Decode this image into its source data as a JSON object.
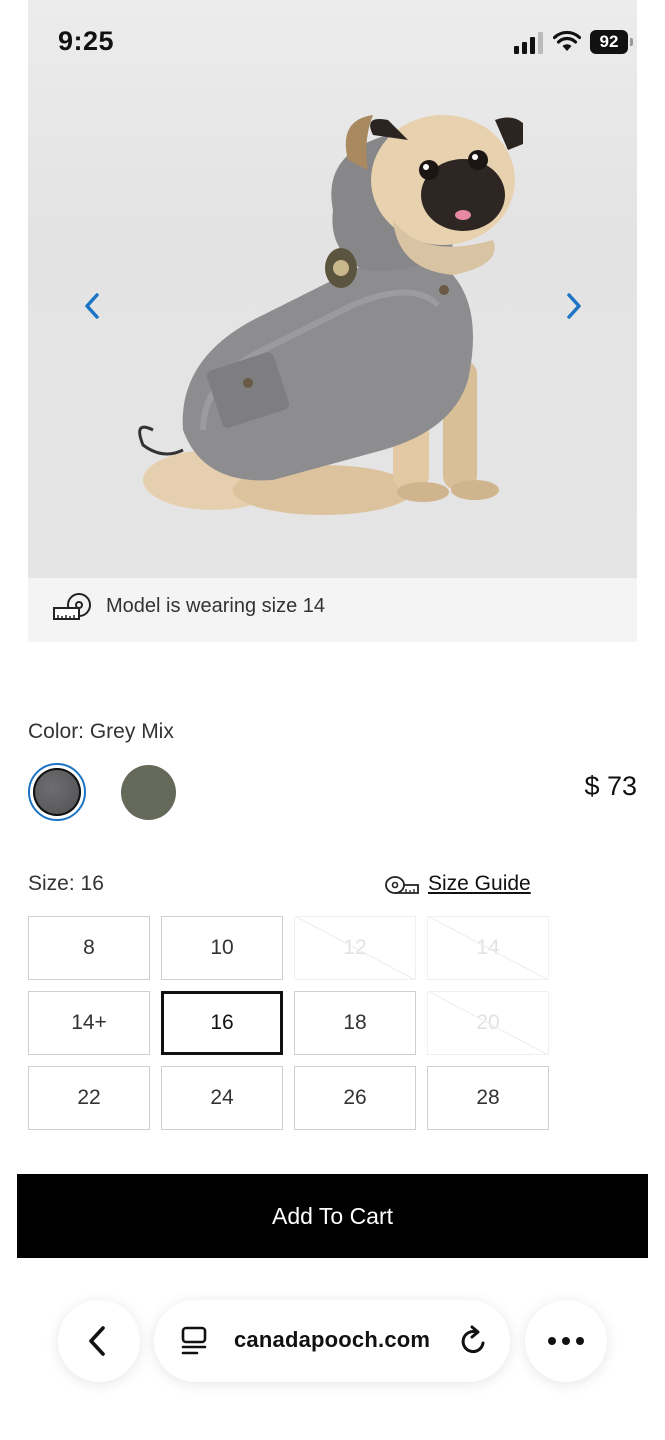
{
  "status_bar": {
    "time": "9:25",
    "battery": "92"
  },
  "gallery": {
    "prev_icon": "chevron-left-icon",
    "next_icon": "chevron-right-icon",
    "accent_color": "#1d74c4"
  },
  "model_note": {
    "icon": "measuring-tape-icon",
    "text": "Model is wearing size 14"
  },
  "color": {
    "label": "Color: Grey Mix",
    "swatches": [
      {
        "name": "Grey Mix",
        "hex": "#58585b",
        "selected": true
      },
      {
        "name": "Olive",
        "hex": "#65695a",
        "selected": false
      }
    ]
  },
  "price": "$ 73",
  "size": {
    "label": "Size: 16",
    "guide_label": "Size Guide",
    "options": [
      {
        "label": "8",
        "state": "available"
      },
      {
        "label": "10",
        "state": "available"
      },
      {
        "label": "12",
        "state": "unavailable"
      },
      {
        "label": "14",
        "state": "unavailable"
      },
      {
        "label": "14+",
        "state": "available"
      },
      {
        "label": "16",
        "state": "selected"
      },
      {
        "label": "18",
        "state": "available"
      },
      {
        "label": "20",
        "state": "unavailable"
      },
      {
        "label": "22",
        "state": "available"
      },
      {
        "label": "24",
        "state": "available"
      },
      {
        "label": "26",
        "state": "available"
      },
      {
        "label": "28",
        "state": "available"
      }
    ]
  },
  "cart": {
    "label": "Add To Cart"
  },
  "browser": {
    "url": "canadapooch.com"
  }
}
